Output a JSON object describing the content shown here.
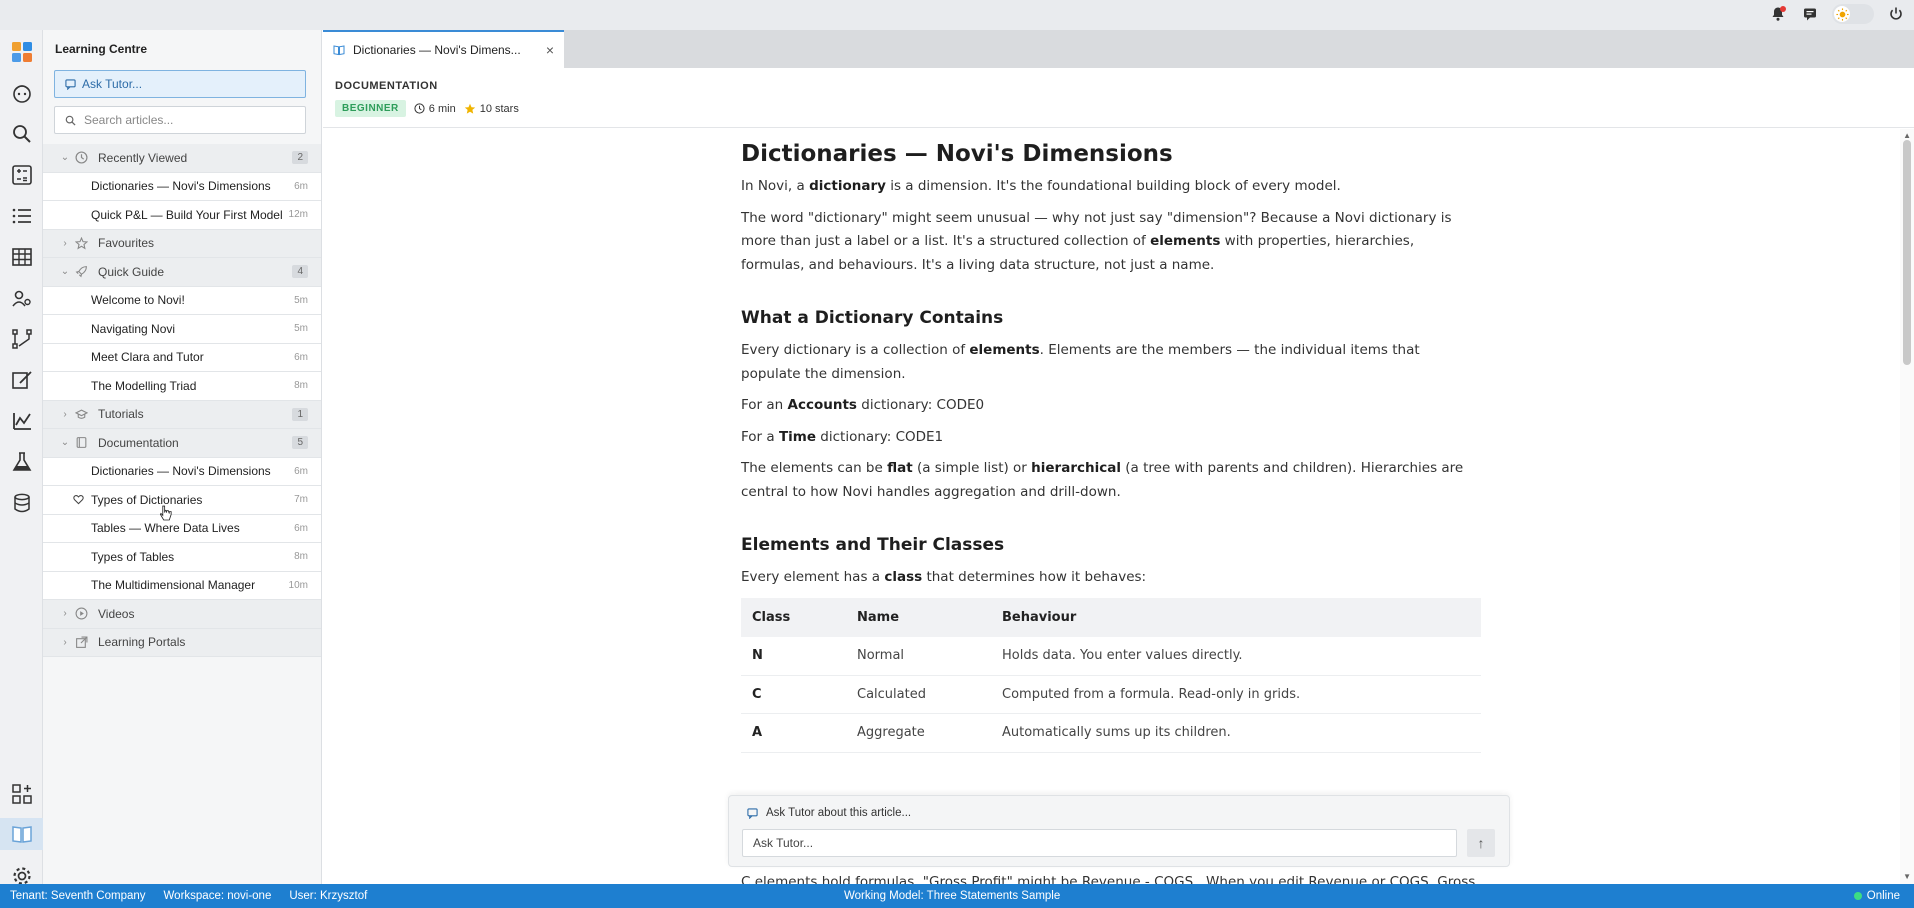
{
  "sidebar": {
    "title": "Learning Centre",
    "ask_label": "Ask Tutor...",
    "search_placeholder": "Search articles...",
    "sections": {
      "recent": {
        "label": "Recently Viewed",
        "count": "2"
      },
      "favourites": {
        "label": "Favourites"
      },
      "quick_guide": {
        "label": "Quick Guide",
        "count": "4"
      },
      "tutorials": {
        "label": "Tutorials",
        "count": "1"
      },
      "documentation": {
        "label": "Documentation",
        "count": "5"
      },
      "videos": {
        "label": "Videos"
      },
      "portals": {
        "label": "Learning Portals"
      }
    },
    "recent_items": [
      {
        "label": "Dictionaries — Novi's Dimensions",
        "time": "6m"
      },
      {
        "label": "Quick P&L — Build Your First Model",
        "time": "12m"
      }
    ],
    "quick_items": [
      {
        "label": "Welcome to Novi!",
        "time": "5m"
      },
      {
        "label": "Navigating Novi",
        "time": "5m"
      },
      {
        "label": "Meet Clara and Tutor",
        "time": "6m"
      },
      {
        "label": "The Modelling Triad",
        "time": "8m"
      }
    ],
    "doc_items": [
      {
        "label": "Dictionaries — Novi's Dimensions",
        "time": "6m"
      },
      {
        "label": "Types of Dictionaries",
        "time": "7m"
      },
      {
        "label": "Tables — Where Data Lives",
        "time": "6m"
      },
      {
        "label": "Types of Tables",
        "time": "8m"
      },
      {
        "label": "The Multidimensional Manager",
        "time": "10m"
      }
    ]
  },
  "tab": {
    "label": "Dictionaries — Novi's Dimens..."
  },
  "doc": {
    "category": "DOCUMENTATION",
    "level": "BEGINNER",
    "duration": "6 min",
    "stars": "10 stars"
  },
  "article": {
    "title": "Dictionaries — Novi's Dimensions",
    "p1_a": "In Novi, a ",
    "p1_b": "dictionary",
    "p1_c": " is a dimension. It's the foundational building block of every model.",
    "p2_a": "The word \"dictionary\" might seem unusual — why not just say \"dimension\"? Because a Novi dictionary is more than just a label or a list. It's a structured collection of ",
    "p2_b": "elements",
    "p2_c": " with properties, hierarchies, formulas, and behaviours. It's a living data structure, not just a name.",
    "h2_1": "What a Dictionary Contains",
    "p3_a": "Every dictionary is a collection of ",
    "p3_b": "elements",
    "p3_c": ". Elements are the members — the individual items that populate the dimension.",
    "p4_a": "For an ",
    "p4_b": "Accounts",
    "p4_c": " dictionary: CODE0",
    "p5_a": "For a ",
    "p5_b": "Time",
    "p5_c": " dictionary: CODE1",
    "p6_a": "The elements can be ",
    "p6_b": "flat",
    "p6_c": " (a simple list) or ",
    "p6_d": "hierarchical",
    "p6_e": " (a tree with parents and children). Hierarchies are central to how Novi handles aggregation and drill-down.",
    "h2_2": "Elements and Their Classes",
    "p7_a": "Every element has a ",
    "p7_b": "class",
    "p7_c": " that determines how it behaves:",
    "table": {
      "headers": [
        "Class",
        "Name",
        "Behaviour"
      ],
      "rows": [
        [
          "N",
          "Normal",
          "Holds data. You enter values directly."
        ],
        [
          "C",
          "Calculated",
          "Computed from a formula. Read-only in grids."
        ],
        [
          "A",
          "Aggregate",
          "Automatically sums up its children."
        ]
      ]
    },
    "cut_line": "C elements hold formulas. \"Gross Profit\" might be  Revenue - COGS . When you edit Revenue or COGS, Gross"
  },
  "tutor": {
    "heading": "Ask Tutor about this article...",
    "input_value": "Ask Tutor..."
  },
  "status": {
    "tenant": "Tenant: Seventh Company",
    "workspace": "Workspace: novi-one",
    "user": "User: Krzysztof",
    "model": "Working Model: Three Statements Sample",
    "online": "Online"
  },
  "colors": {
    "accent": "#1e7fd0",
    "beginner": "#2e9d5a",
    "star": "#f0b400"
  }
}
